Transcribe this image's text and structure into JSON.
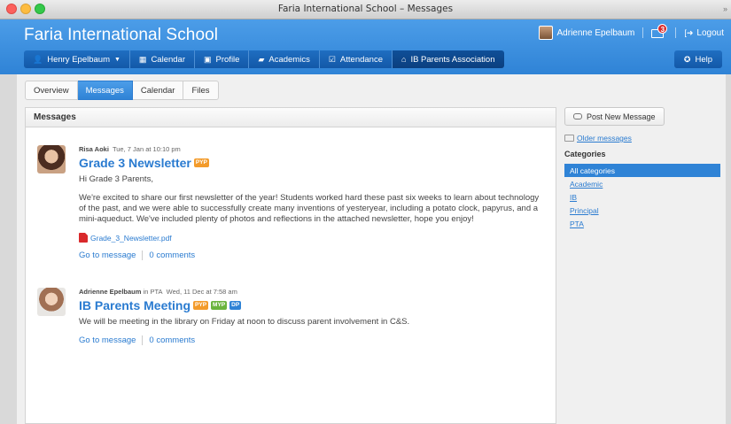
{
  "window": {
    "title": "Faria International School – Messages"
  },
  "header": {
    "school_name": "Faria International School",
    "user_name": "Adrienne Epelbaum",
    "unread_count": "3",
    "logout_label": "Logout",
    "help_label": "Help",
    "nav": [
      {
        "label": "Henry Epelbaum",
        "icon": "person-icon"
      },
      {
        "label": "Calendar",
        "icon": "calendar-icon"
      },
      {
        "label": "Profile",
        "icon": "id-card-icon"
      },
      {
        "label": "Academics",
        "icon": "book-icon"
      },
      {
        "label": "Attendance",
        "icon": "checkbox-icon"
      },
      {
        "label": "IB Parents Association",
        "icon": "home-icon"
      }
    ]
  },
  "tabs": [
    "Overview",
    "Messages",
    "Calendar",
    "Files"
  ],
  "panel": {
    "title": "Messages"
  },
  "messages": [
    {
      "author": "Risa Aoki",
      "context": "",
      "date": "Tue, 7 Jan at 10:10 pm",
      "title": "Grade 3 Newsletter",
      "tags": [
        "PYP"
      ],
      "greeting": "Hi Grade 3 Parents,",
      "body": "We're excited to share our first newsletter of the year! Students worked hard these past six weeks to learn about technology of the past, and we were able to successfully create many inventions of yesteryear, including a potato clock, papyrus, and a mini-aqueduct. We've included plenty of photos and reflections in the attached newsletter, hope you enjoy!",
      "attachment": "Grade_3_Newsletter.pdf",
      "go_to": "Go to message",
      "comments": "0 comments"
    },
    {
      "author": "Adrienne Epelbaum",
      "context": "in PTA",
      "date": "Wed, 11 Dec at 7:58 am",
      "title": "IB Parents Meeting",
      "tags": [
        "PYP",
        "MYP",
        "DP"
      ],
      "body": "We will be meeting in the library on Friday at noon to discuss parent involvement in C&S.",
      "go_to": "Go to message",
      "comments": "0 comments"
    }
  ],
  "sidebar": {
    "post_button": "Post New Message",
    "older_link": "Older messages",
    "categories_heading": "Categories",
    "categories": [
      "All categories",
      "Academic",
      "IB",
      "Principal",
      "PTA"
    ]
  },
  "colors": {
    "header_blue": "#2f83d6",
    "link_blue": "#2a7bd0",
    "pyp": "#f39b2b",
    "myp": "#6ab43e",
    "dp": "#2f83d6"
  }
}
